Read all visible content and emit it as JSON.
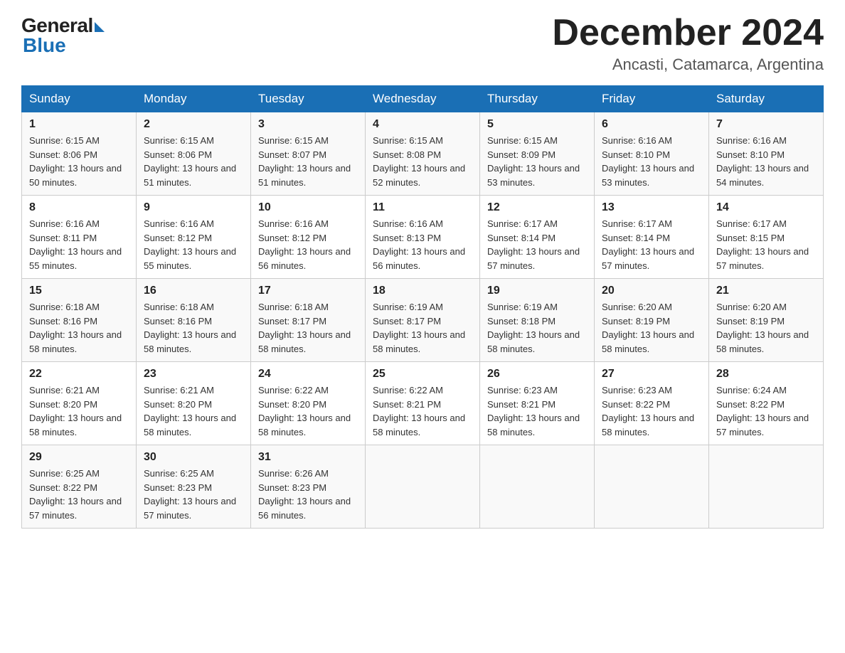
{
  "header": {
    "logo": {
      "general": "General",
      "blue": "Blue"
    },
    "title": "December 2024",
    "location": "Ancasti, Catamarca, Argentina"
  },
  "days_of_week": [
    "Sunday",
    "Monday",
    "Tuesday",
    "Wednesday",
    "Thursday",
    "Friday",
    "Saturday"
  ],
  "weeks": [
    [
      {
        "day": "1",
        "sunrise": "6:15 AM",
        "sunset": "8:06 PM",
        "daylight": "13 hours and 50 minutes."
      },
      {
        "day": "2",
        "sunrise": "6:15 AM",
        "sunset": "8:06 PM",
        "daylight": "13 hours and 51 minutes."
      },
      {
        "day": "3",
        "sunrise": "6:15 AM",
        "sunset": "8:07 PM",
        "daylight": "13 hours and 51 minutes."
      },
      {
        "day": "4",
        "sunrise": "6:15 AM",
        "sunset": "8:08 PM",
        "daylight": "13 hours and 52 minutes."
      },
      {
        "day": "5",
        "sunrise": "6:15 AM",
        "sunset": "8:09 PM",
        "daylight": "13 hours and 53 minutes."
      },
      {
        "day": "6",
        "sunrise": "6:16 AM",
        "sunset": "8:10 PM",
        "daylight": "13 hours and 53 minutes."
      },
      {
        "day": "7",
        "sunrise": "6:16 AM",
        "sunset": "8:10 PM",
        "daylight": "13 hours and 54 minutes."
      }
    ],
    [
      {
        "day": "8",
        "sunrise": "6:16 AM",
        "sunset": "8:11 PM",
        "daylight": "13 hours and 55 minutes."
      },
      {
        "day": "9",
        "sunrise": "6:16 AM",
        "sunset": "8:12 PM",
        "daylight": "13 hours and 55 minutes."
      },
      {
        "day": "10",
        "sunrise": "6:16 AM",
        "sunset": "8:12 PM",
        "daylight": "13 hours and 56 minutes."
      },
      {
        "day": "11",
        "sunrise": "6:16 AM",
        "sunset": "8:13 PM",
        "daylight": "13 hours and 56 minutes."
      },
      {
        "day": "12",
        "sunrise": "6:17 AM",
        "sunset": "8:14 PM",
        "daylight": "13 hours and 57 minutes."
      },
      {
        "day": "13",
        "sunrise": "6:17 AM",
        "sunset": "8:14 PM",
        "daylight": "13 hours and 57 minutes."
      },
      {
        "day": "14",
        "sunrise": "6:17 AM",
        "sunset": "8:15 PM",
        "daylight": "13 hours and 57 minutes."
      }
    ],
    [
      {
        "day": "15",
        "sunrise": "6:18 AM",
        "sunset": "8:16 PM",
        "daylight": "13 hours and 58 minutes."
      },
      {
        "day": "16",
        "sunrise": "6:18 AM",
        "sunset": "8:16 PM",
        "daylight": "13 hours and 58 minutes."
      },
      {
        "day": "17",
        "sunrise": "6:18 AM",
        "sunset": "8:17 PM",
        "daylight": "13 hours and 58 minutes."
      },
      {
        "day": "18",
        "sunrise": "6:19 AM",
        "sunset": "8:17 PM",
        "daylight": "13 hours and 58 minutes."
      },
      {
        "day": "19",
        "sunrise": "6:19 AM",
        "sunset": "8:18 PM",
        "daylight": "13 hours and 58 minutes."
      },
      {
        "day": "20",
        "sunrise": "6:20 AM",
        "sunset": "8:19 PM",
        "daylight": "13 hours and 58 minutes."
      },
      {
        "day": "21",
        "sunrise": "6:20 AM",
        "sunset": "8:19 PM",
        "daylight": "13 hours and 58 minutes."
      }
    ],
    [
      {
        "day": "22",
        "sunrise": "6:21 AM",
        "sunset": "8:20 PM",
        "daylight": "13 hours and 58 minutes."
      },
      {
        "day": "23",
        "sunrise": "6:21 AM",
        "sunset": "8:20 PM",
        "daylight": "13 hours and 58 minutes."
      },
      {
        "day": "24",
        "sunrise": "6:22 AM",
        "sunset": "8:20 PM",
        "daylight": "13 hours and 58 minutes."
      },
      {
        "day": "25",
        "sunrise": "6:22 AM",
        "sunset": "8:21 PM",
        "daylight": "13 hours and 58 minutes."
      },
      {
        "day": "26",
        "sunrise": "6:23 AM",
        "sunset": "8:21 PM",
        "daylight": "13 hours and 58 minutes."
      },
      {
        "day": "27",
        "sunrise": "6:23 AM",
        "sunset": "8:22 PM",
        "daylight": "13 hours and 58 minutes."
      },
      {
        "day": "28",
        "sunrise": "6:24 AM",
        "sunset": "8:22 PM",
        "daylight": "13 hours and 57 minutes."
      }
    ],
    [
      {
        "day": "29",
        "sunrise": "6:25 AM",
        "sunset": "8:22 PM",
        "daylight": "13 hours and 57 minutes."
      },
      {
        "day": "30",
        "sunrise": "6:25 AM",
        "sunset": "8:23 PM",
        "daylight": "13 hours and 57 minutes."
      },
      {
        "day": "31",
        "sunrise": "6:26 AM",
        "sunset": "8:23 PM",
        "daylight": "13 hours and 56 minutes."
      },
      null,
      null,
      null,
      null
    ]
  ]
}
